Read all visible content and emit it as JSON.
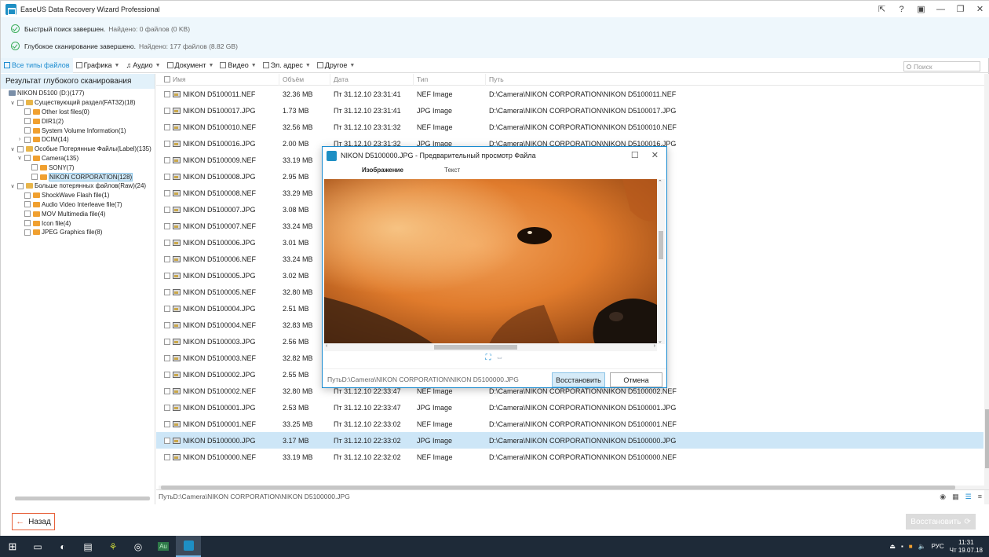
{
  "window": {
    "title": "EaseUS Data Recovery Wizard Professional",
    "controls": [
      "⇱",
      "?",
      "▣",
      "—",
      "❐",
      "✕"
    ]
  },
  "status": {
    "quick": {
      "label": "Быстрый поиск завершен.",
      "detail": "Найдено: 0 файлов (0 KB)"
    },
    "deep": {
      "label": "Глубокое сканирование завершено.",
      "detail": "Найдено: 177 файлов (8.82 GB)"
    }
  },
  "filters": {
    "all": "Все типы файлов",
    "graphics": "Графика",
    "audio": "Аудио",
    "document": "Документ",
    "video": "Видео",
    "email": "Эл. адрес",
    "other": "Другое",
    "search_placeholder": "Поиск"
  },
  "left_panel": {
    "title": "Результат глубокого сканирования",
    "tree": [
      {
        "label": "NIKON D5100 (D:)(177)",
        "level": 0,
        "toggle": ""
      },
      {
        "label": "Существующий раздел(FAT32)(18)",
        "level": 1,
        "toggle": "∨"
      },
      {
        "label": "Other lost files(0)",
        "level": 2,
        "toggle": ""
      },
      {
        "label": "DIR1(2)",
        "level": 2,
        "toggle": ""
      },
      {
        "label": "System Volume Information(1)",
        "level": 2,
        "toggle": ""
      },
      {
        "label": "DCIM(14)",
        "level": 2,
        "toggle": "›"
      },
      {
        "label": "Особые Потерянные Файлы(Label)(135)",
        "level": 1,
        "toggle": "∨"
      },
      {
        "label": "Camera(135)",
        "level": 2,
        "toggle": "∨"
      },
      {
        "label": "SONY(7)",
        "level": 3,
        "toggle": ""
      },
      {
        "label": "NIKON CORPORATION(128)",
        "level": 3,
        "toggle": "",
        "selected": true
      },
      {
        "label": "Больше потерянных файлов(Raw)(24)",
        "level": 1,
        "toggle": "∨"
      },
      {
        "label": "ShockWave Flash file(1)",
        "level": 2,
        "toggle": ""
      },
      {
        "label": "Audio Video Interleave file(7)",
        "level": 2,
        "toggle": ""
      },
      {
        "label": "MOV Multimedia file(4)",
        "level": 2,
        "toggle": ""
      },
      {
        "label": "Icon file(4)",
        "level": 2,
        "toggle": ""
      },
      {
        "label": "JPEG Graphics file(8)",
        "level": 2,
        "toggle": ""
      }
    ]
  },
  "table": {
    "headers": {
      "name": "Имя",
      "size": "Объём",
      "date": "Дата",
      "type": "Тип",
      "path": "Путь"
    },
    "rows": [
      {
        "name": "NIKON D5100011.NEF",
        "size": "32.36 MB",
        "date": "Пт 31.12.10 23:31:41",
        "type": "NEF Image",
        "path": "D:\\Camera\\NIKON CORPORATION\\NIKON D5100011.NEF"
      },
      {
        "name": "NIKON D5100017.JPG",
        "size": "1.73 MB",
        "date": "Пт 31.12.10 23:31:41",
        "type": "JPG Image",
        "path": "D:\\Camera\\NIKON CORPORATION\\NIKON D5100017.JPG"
      },
      {
        "name": "NIKON D5100010.NEF",
        "size": "32.56 MB",
        "date": "Пт 31.12.10 23:31:32",
        "type": "NEF Image",
        "path": "D:\\Camera\\NIKON CORPORATION\\NIKON D5100010.NEF"
      },
      {
        "name": "NIKON D5100016.JPG",
        "size": "2.00 MB",
        "date": "Пт 31.12.10 23:31:32",
        "type": "JPG Image",
        "path": "D:\\Camera\\NIKON CORPORATION\\NIKON D5100016.JPG"
      },
      {
        "name": "NIKON D5100009.NEF",
        "size": "33.19 MB",
        "date": "",
        "type": "",
        "path": ""
      },
      {
        "name": "NIKON D5100008.JPG",
        "size": "2.95 MB",
        "date": "",
        "type": "",
        "path": ""
      },
      {
        "name": "NIKON D5100008.NEF",
        "size": "33.29 MB",
        "date": "",
        "type": "",
        "path": ""
      },
      {
        "name": "NIKON D5100007.JPG",
        "size": "3.08 MB",
        "date": "",
        "type": "",
        "path": ""
      },
      {
        "name": "NIKON D5100007.NEF",
        "size": "33.24 MB",
        "date": "",
        "type": "",
        "path": ""
      },
      {
        "name": "NIKON D5100006.JPG",
        "size": "3.01 MB",
        "date": "",
        "type": "",
        "path": ""
      },
      {
        "name": "NIKON D5100006.NEF",
        "size": "33.24 MB",
        "date": "",
        "type": "",
        "path": ""
      },
      {
        "name": "NIKON D5100005.JPG",
        "size": "3.02 MB",
        "date": "",
        "type": "",
        "path": ""
      },
      {
        "name": "NIKON D5100005.NEF",
        "size": "32.80 MB",
        "date": "",
        "type": "",
        "path": ""
      },
      {
        "name": "NIKON D5100004.JPG",
        "size": "2.51 MB",
        "date": "",
        "type": "",
        "path": ""
      },
      {
        "name": "NIKON D5100004.NEF",
        "size": "32.83 MB",
        "date": "",
        "type": "",
        "path": ""
      },
      {
        "name": "NIKON D5100003.JPG",
        "size": "2.56 MB",
        "date": "",
        "type": "",
        "path": ""
      },
      {
        "name": "NIKON D5100003.NEF",
        "size": "32.82 MB",
        "date": "",
        "type": "",
        "path": ""
      },
      {
        "name": "NIKON D5100002.JPG",
        "size": "2.55 MB",
        "date": "",
        "type": "",
        "path": ""
      },
      {
        "name": "NIKON D5100002.NEF",
        "size": "32.80 MB",
        "date": "Пт 31.12.10 22:33:47",
        "type": "NEF Image",
        "path": "D:\\Camera\\NIKON CORPORATION\\NIKON D5100002.NEF"
      },
      {
        "name": "NIKON D5100001.JPG",
        "size": "2.53 MB",
        "date": "Пт 31.12.10 22:33:47",
        "type": "JPG Image",
        "path": "D:\\Camera\\NIKON CORPORATION\\NIKON D5100001.JPG"
      },
      {
        "name": "NIKON D5100001.NEF",
        "size": "33.25 MB",
        "date": "Пт 31.12.10 22:33:02",
        "type": "NEF Image",
        "path": "D:\\Camera\\NIKON CORPORATION\\NIKON D5100001.NEF"
      },
      {
        "name": "NIKON D5100000.JPG",
        "size": "3.17 MB",
        "date": "Пт 31.12.10 22:33:02",
        "type": "JPG Image",
        "path": "D:\\Camera\\NIKON CORPORATION\\NIKON D5100000.JPG",
        "selected": true
      },
      {
        "name": "NIKON D5100000.NEF",
        "size": "33.19 MB",
        "date": "Пт 31.12.10 22:32:02",
        "type": "NEF Image",
        "path": "D:\\Camera\\NIKON CORPORATION\\NIKON D5100000.NEF"
      }
    ]
  },
  "pathbar": {
    "text": "ПутьD:\\Camera\\NIKON CORPORATION\\NIKON D5100000.JPG"
  },
  "bottom": {
    "back_label": "Назад",
    "restore_label": "Восстановить"
  },
  "dialog": {
    "title": "NIKON D5100000.JPG - Предварительный просмотр Файла",
    "tab_image": "Изображение",
    "tab_text": "Текст",
    "path": "ПутьD:\\Camera\\NIKON CORPORATION\\NIKON D5100000.JPG",
    "restore_label": "Восстановить",
    "cancel_label": "Отмена"
  },
  "taskbar": {
    "tray_lang": "РУС",
    "time": "11:31",
    "date": "Чт 19.07.18"
  },
  "colors": {
    "accent": "#1a8bd0",
    "selected_row": "#cde6f7",
    "back_border": "#e7623b",
    "taskbar": "#1e2a38"
  }
}
